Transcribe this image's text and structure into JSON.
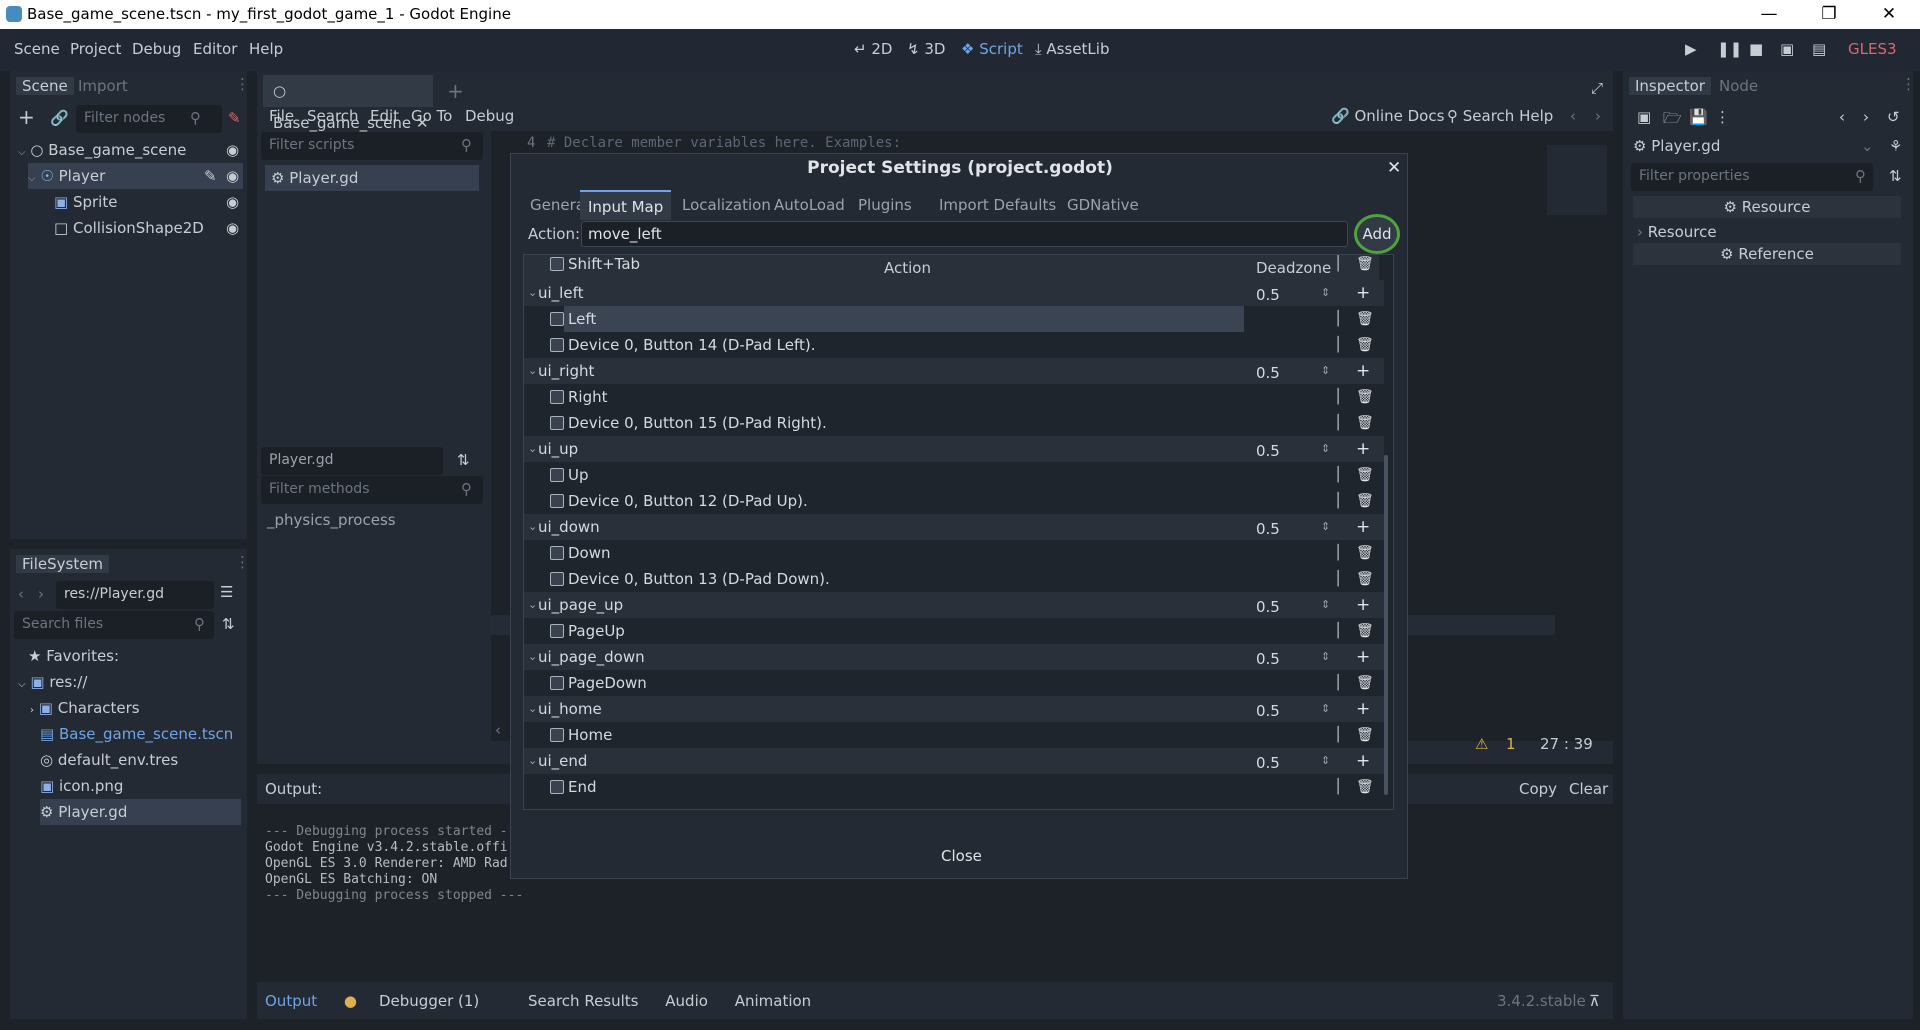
{
  "window": {
    "title": "Base_game_scene.tscn - my_first_godot_game_1 - Godot Engine"
  },
  "menu": [
    "Scene",
    "Project",
    "Debug",
    "Editor",
    "Help"
  ],
  "workspaces": [
    {
      "label": "2D"
    },
    {
      "label": "3D"
    },
    {
      "label": "Script"
    },
    {
      "label": "AssetLib"
    }
  ],
  "renderer": "GLES3",
  "scene_dock": {
    "tabs": [
      "Scene",
      "Import"
    ],
    "filter_placeholder": "Filter nodes",
    "nodes": [
      {
        "label": "Base_game_scene"
      },
      {
        "label": "Player"
      },
      {
        "label": "Sprite"
      },
      {
        "label": "CollisionShape2D"
      }
    ]
  },
  "filesystem": {
    "title": "FileSystem",
    "path": "res://Player.gd",
    "search_placeholder": "Search files",
    "items": [
      {
        "label": "Favorites:"
      },
      {
        "label": "res://"
      },
      {
        "label": "Characters"
      },
      {
        "label": "Base_game_scene.tscn"
      },
      {
        "label": "default_env.tres"
      },
      {
        "label": "icon.png"
      },
      {
        "label": "Player.gd"
      }
    ]
  },
  "script_editor": {
    "tab": "Base_game_scene",
    "menus": [
      "File",
      "Search",
      "Edit",
      "Go To",
      "Debug"
    ],
    "online_docs": "Online Docs",
    "search_help": "Search Help",
    "filter_scripts": "Filter scripts",
    "script_item": "Player.gd",
    "methods_title": "Player.gd",
    "filter_methods": "Filter methods",
    "method": "_physics_process",
    "code_line_no": "4",
    "code_line": "# Declare member variables here. Examples:",
    "warnings": "1",
    "cursor": "27 :   39"
  },
  "output": {
    "title": "Output:",
    "copy": "Copy",
    "clear": "Clear",
    "lines": [
      "--- Debugging process started ---",
      "Godot Engine v3.4.2.stable.offi",
      "OpenGL ES 3.0 Renderer: AMD Rad",
      "OpenGL ES Batching: ON",
      "",
      "--- Debugging process stopped ---"
    ]
  },
  "bottom_tabs": [
    "Output",
    "Debugger (1)",
    "Search Results",
    "Audio",
    "Animation"
  ],
  "version": "3.4.2.stable",
  "inspector": {
    "tabs": [
      "Inspector",
      "Node"
    ],
    "object": "Player.gd",
    "filter_placeholder": "Filter properties",
    "sections": [
      "Resource",
      "Resource",
      "Reference"
    ]
  },
  "dialog": {
    "title": "Project Settings (project.godot)",
    "tabs": [
      "General",
      "Input Map",
      "Localization",
      "AutoLoad",
      "Plugins",
      "Import Defaults",
      "GDNative"
    ],
    "action_label": "Action:",
    "action_value": "move_left",
    "add_label": "Add",
    "col_action": "Action",
    "col_deadzone": "Deadzone",
    "close_label": "Close",
    "rows": [
      {
        "label": "Shift+Tab",
        "group": false,
        "deadzone": ""
      },
      {
        "label": "ui_left",
        "group": true,
        "deadzone": "0.5"
      },
      {
        "label": "Left",
        "group": false,
        "deadzone": "",
        "selected": true
      },
      {
        "label": "Device 0, Button 14 (D-Pad Left).",
        "group": false,
        "deadzone": ""
      },
      {
        "label": "ui_right",
        "group": true,
        "deadzone": "0.5"
      },
      {
        "label": "Right",
        "group": false,
        "deadzone": ""
      },
      {
        "label": "Device 0, Button 15 (D-Pad Right).",
        "group": false,
        "deadzone": ""
      },
      {
        "label": "ui_up",
        "group": true,
        "deadzone": "0.5"
      },
      {
        "label": "Up",
        "group": false,
        "deadzone": ""
      },
      {
        "label": "Device 0, Button 12 (D-Pad Up).",
        "group": false,
        "deadzone": ""
      },
      {
        "label": "ui_down",
        "group": true,
        "deadzone": "0.5"
      },
      {
        "label": "Down",
        "group": false,
        "deadzone": ""
      },
      {
        "label": "Device 0, Button 13 (D-Pad Down).",
        "group": false,
        "deadzone": ""
      },
      {
        "label": "ui_page_up",
        "group": true,
        "deadzone": "0.5"
      },
      {
        "label": "PageUp",
        "group": false,
        "deadzone": ""
      },
      {
        "label": "ui_page_down",
        "group": true,
        "deadzone": "0.5"
      },
      {
        "label": "PageDown",
        "group": false,
        "deadzone": ""
      },
      {
        "label": "ui_home",
        "group": true,
        "deadzone": "0.5"
      },
      {
        "label": "Home",
        "group": false,
        "deadzone": ""
      },
      {
        "label": "ui_end",
        "group": true,
        "deadzone": "0.5"
      },
      {
        "label": "End",
        "group": false,
        "deadzone": ""
      }
    ]
  }
}
